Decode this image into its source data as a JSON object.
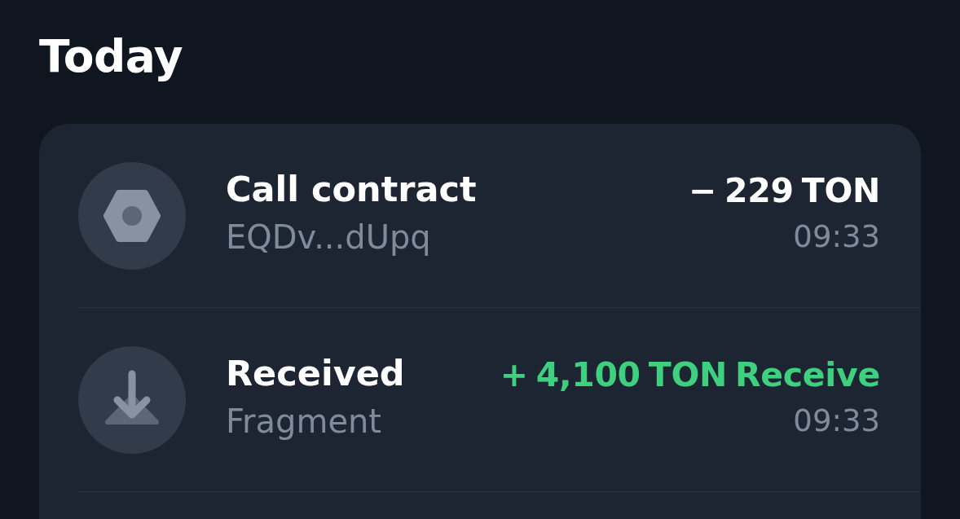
{
  "section_title": "Today",
  "transactions": [
    {
      "kind": "contract",
      "title": "Call contract",
      "subtitle": "EQDv...dUpq",
      "amount": "− 229 TON",
      "incoming": false,
      "time": "09:33"
    },
    {
      "kind": "received",
      "title": "Received",
      "subtitle": "Fragment",
      "amount": "+ 4,100 TON Receive",
      "incoming": true,
      "time": "09:33"
    }
  ]
}
